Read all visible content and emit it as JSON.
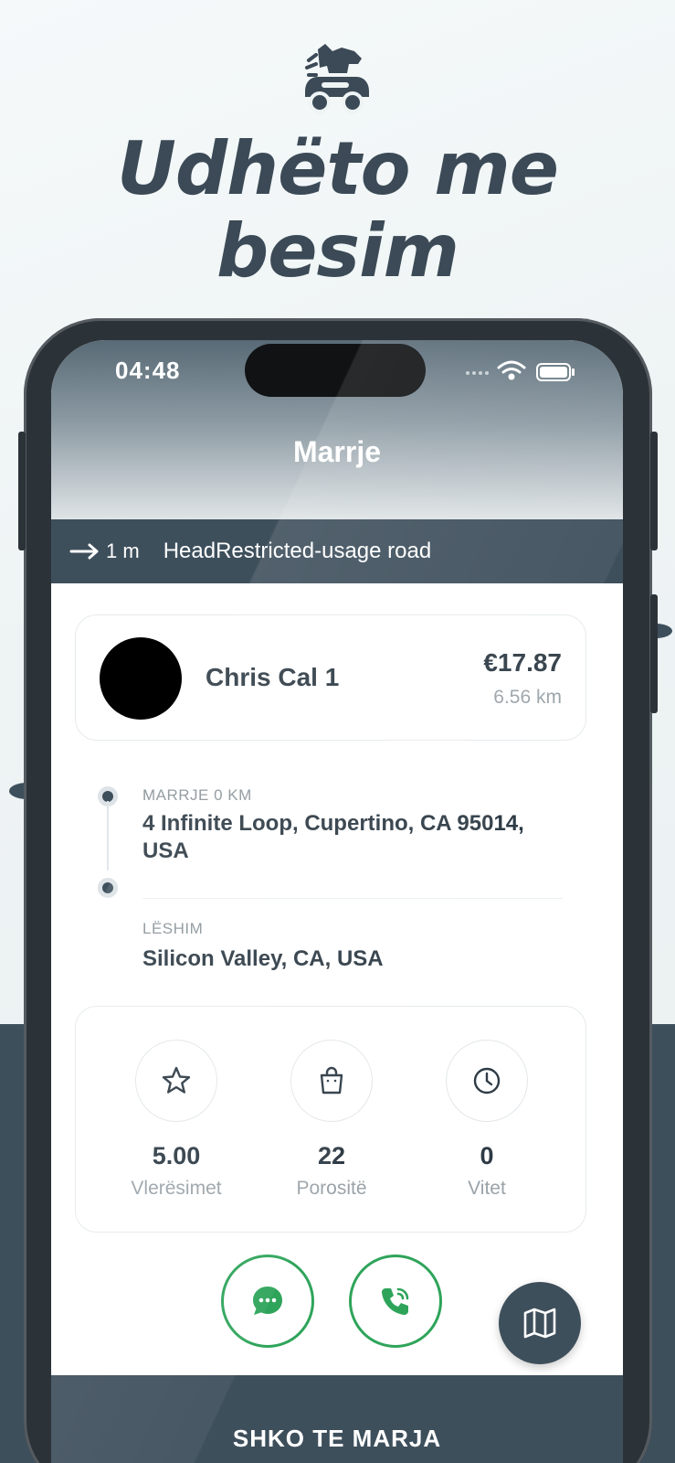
{
  "marketing": {
    "headline_line1": "Udhëto me",
    "headline_line2": "besim"
  },
  "status_bar": {
    "time": "04:48"
  },
  "header": {
    "title": "Marrje"
  },
  "navigation": {
    "distance": "1 m",
    "instruction": "HeadRestricted-usage road"
  },
  "rider": {
    "name": "Chris Cal 1",
    "price": "€17.87",
    "distance": "6.56 km"
  },
  "route": {
    "pickup_label": "MARRJE 0 KM",
    "pickup_address": "4 Infinite Loop, Cupertino, CA 95014, USA",
    "dropoff_label": "LËSHIM",
    "dropoff_address": "Silicon Valley, CA, USA"
  },
  "stats": [
    {
      "icon": "star-icon",
      "value": "5.00",
      "label": "Vlerësimet"
    },
    {
      "icon": "shopping-bag-icon",
      "value": "22",
      "label": "Porositë"
    },
    {
      "icon": "clock-icon",
      "value": "0",
      "label": "Vitet"
    }
  ],
  "actions": {
    "chat_icon": "chat-bubble-icon",
    "call_icon": "phone-call-icon",
    "map_icon": "map-icon"
  },
  "bottom_button": {
    "label": "SHKO TE MARJA"
  },
  "colors": {
    "primary": "#3e4f5c",
    "accent_green": "#2ea45a",
    "background": "#eef3f4",
    "text_dark": "#2e3b45",
    "text_muted": "#9aa3a9"
  }
}
